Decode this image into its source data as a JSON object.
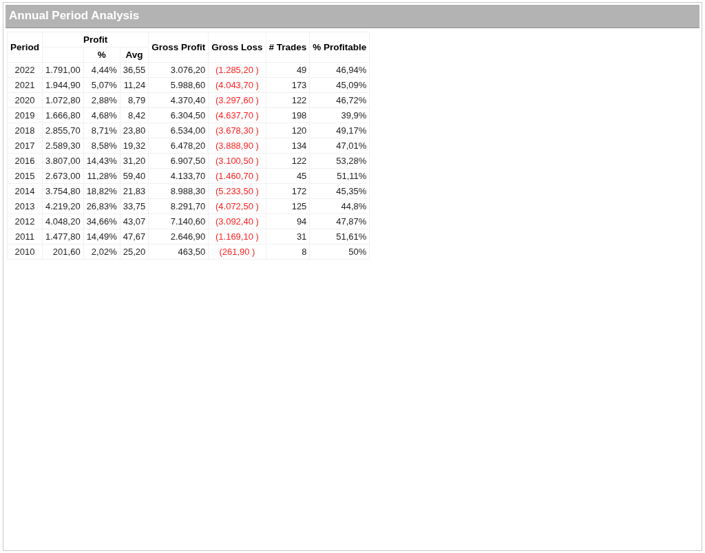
{
  "window": {
    "title": "Annual Period Analysis"
  },
  "table": {
    "columns": {
      "period": "Period",
      "profit": "Profit",
      "profit_pct": "%",
      "profit_avg": "Avg",
      "gross_profit": "Gross Profit",
      "gross_loss": "Gross Loss",
      "trades": "# Trades",
      "pct_profitable": "% Profitable"
    },
    "rows": [
      {
        "period": "2022",
        "profit": "1.791,00",
        "pct": "4,44%",
        "avg": "36,55",
        "gross_profit": "3.076,20",
        "gross_loss": "(1.285,20 )",
        "trades": "49",
        "pct_profitable": "46,94%"
      },
      {
        "period": "2021",
        "profit": "1.944,90",
        "pct": "5,07%",
        "avg": "11,24",
        "gross_profit": "5.988,60",
        "gross_loss": "(4.043,70 )",
        "trades": "173",
        "pct_profitable": "45,09%"
      },
      {
        "period": "2020",
        "profit": "1.072,80",
        "pct": "2,88%",
        "avg": "8,79",
        "gross_profit": "4.370,40",
        "gross_loss": "(3.297,60 )",
        "trades": "122",
        "pct_profitable": "46,72%"
      },
      {
        "period": "2019",
        "profit": "1.666,80",
        "pct": "4,68%",
        "avg": "8,42",
        "gross_profit": "6.304,50",
        "gross_loss": "(4.637,70 )",
        "trades": "198",
        "pct_profitable": "39,9%"
      },
      {
        "period": "2018",
        "profit": "2.855,70",
        "pct": "8,71%",
        "avg": "23,80",
        "gross_profit": "6.534,00",
        "gross_loss": "(3.678,30 )",
        "trades": "120",
        "pct_profitable": "49,17%"
      },
      {
        "period": "2017",
        "profit": "2.589,30",
        "pct": "8,58%",
        "avg": "19,32",
        "gross_profit": "6.478,20",
        "gross_loss": "(3.888,90 )",
        "trades": "134",
        "pct_profitable": "47,01%"
      },
      {
        "period": "2016",
        "profit": "3.807,00",
        "pct": "14,43%",
        "avg": "31,20",
        "gross_profit": "6.907,50",
        "gross_loss": "(3.100,50 )",
        "trades": "122",
        "pct_profitable": "53,28%"
      },
      {
        "period": "2015",
        "profit": "2.673,00",
        "pct": "11,28%",
        "avg": "59,40",
        "gross_profit": "4.133,70",
        "gross_loss": "(1.460,70 )",
        "trades": "45",
        "pct_profitable": "51,11%"
      },
      {
        "period": "2014",
        "profit": "3.754,80",
        "pct": "18,82%",
        "avg": "21,83",
        "gross_profit": "8.988,30",
        "gross_loss": "(5.233,50 )",
        "trades": "172",
        "pct_profitable": "45,35%"
      },
      {
        "period": "2013",
        "profit": "4.219,20",
        "pct": "26,83%",
        "avg": "33,75",
        "gross_profit": "8.291,70",
        "gross_loss": "(4.072,50 )",
        "trades": "125",
        "pct_profitable": "44,8%"
      },
      {
        "period": "2012",
        "profit": "4.048,20",
        "pct": "34,66%",
        "avg": "43,07",
        "gross_profit": "7.140,60",
        "gross_loss": "(3.092,40 )",
        "trades": "94",
        "pct_profitable": "47,87%"
      },
      {
        "period": "2011",
        "profit": "1.477,80",
        "pct": "14,49%",
        "avg": "47,67",
        "gross_profit": "2.646,90",
        "gross_loss": "(1.169,10 )",
        "trades": "31",
        "pct_profitable": "51,61%"
      },
      {
        "period": "2010",
        "profit": "201,60",
        "pct": "2,02%",
        "avg": "25,20",
        "gross_profit": "463,50",
        "gross_loss": "(261,90 )",
        "trades": "8",
        "pct_profitable": "50%"
      }
    ]
  }
}
